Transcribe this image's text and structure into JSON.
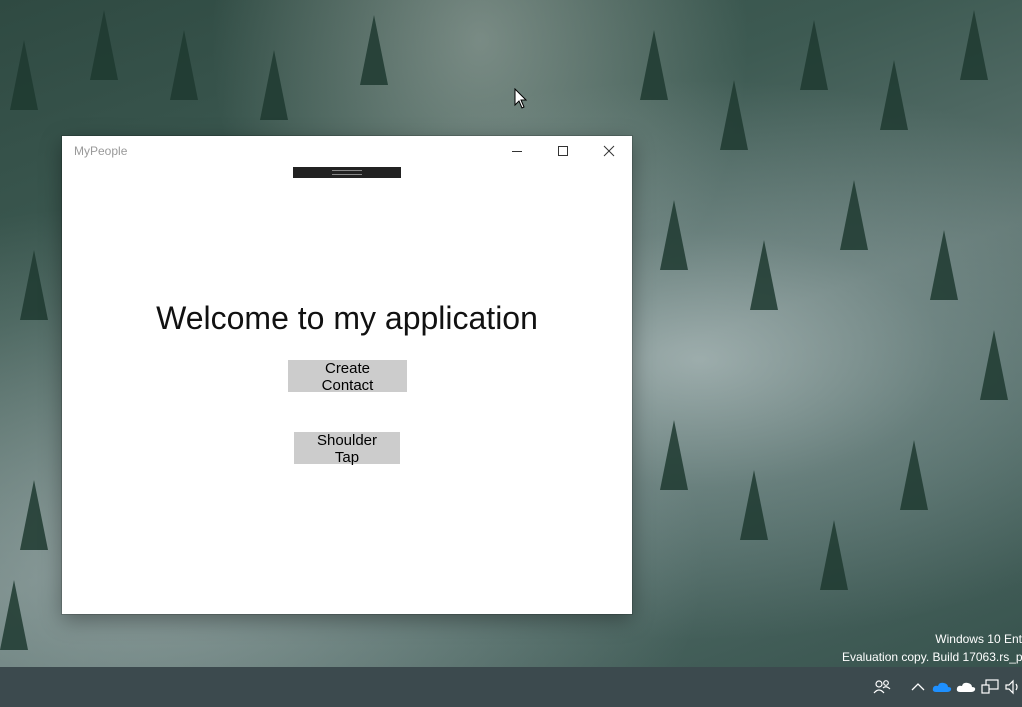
{
  "window": {
    "title": "MyPeople",
    "controls": {
      "minimize": "minimize-icon",
      "maximize": "maximize-icon",
      "close": "close-icon"
    }
  },
  "main": {
    "welcome_text": "Welcome to my application",
    "create_contact_label": "Create Contact",
    "shoulder_tap_label": "Shoulder Tap"
  },
  "watermark": {
    "line1": "Windows 10 Ent",
    "line2": "Evaluation copy. Build 17063.rs_p"
  },
  "taskbar": {
    "tray_icons": [
      "people-icon",
      "chevron-up-icon",
      "onedrive-icon",
      "onedrive-personal-icon",
      "network-icon",
      "volume-icon"
    ]
  },
  "colors": {
    "button_bg": "#cccccc",
    "taskbar_bg": "#3c4a4e",
    "onedrive_blue": "#1e90ff"
  }
}
